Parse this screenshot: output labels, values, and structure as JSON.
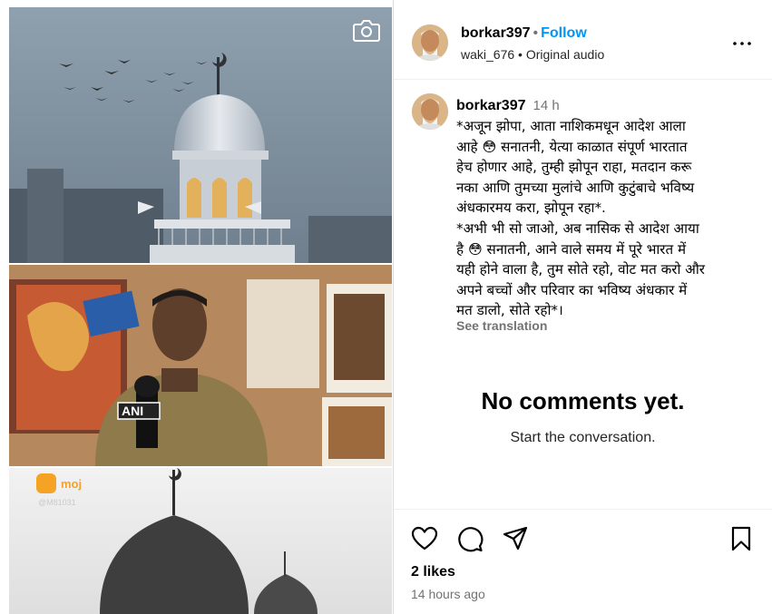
{
  "post": {
    "username": "borkar397",
    "follow_label": "Follow",
    "audio_user": "waki_676",
    "audio_label": "Original audio",
    "caption_time": "14 h",
    "caption": "*अजून झोपा, आता नाशिकमधून आदेश आला\nआहे 😳 सनातनी, येत्या काळात संपूर्ण भारतात\nहेच होणार आहे, तुम्ही झोपून राहा, मतदान करू\nनका आणि तुमच्या मुलांचे आणि कुटुंबाचे भविष्य\nअंधकारमय करा, झोपून रहा*.\n*अभी भी सो जाओ, अब नासिक से आदेश आया\nहै 😳 सनातनी, आने वाले समय में पूरे भारत में\nयही होने वाला है, तुम सोते रहो, वोट मत करो और\nअपने बच्चों और परिवार का भविष्य अंधकार में\nमत डालो, सोते रहो*।",
    "see_translation": "See translation",
    "no_comments_title": "No comments yet.",
    "no_comments_sub": "Start the conversation.",
    "likes": "2 likes",
    "time_ago": "14 hours ago"
  },
  "media": {
    "overlay_badge": "ANI",
    "watermark_brand": "moj",
    "watermark_handle": "@M81031"
  },
  "icons": {
    "camera": "camera-icon",
    "more": "more-options-icon",
    "like": "heart-icon",
    "comment": "comment-icon",
    "share": "share-icon",
    "save": "bookmark-icon"
  }
}
